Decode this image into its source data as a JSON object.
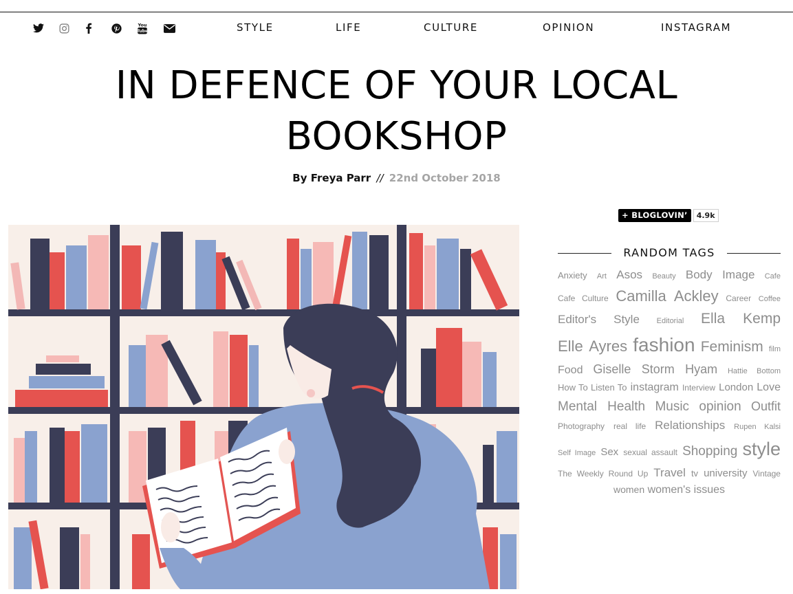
{
  "social": [
    {
      "name": "twitter-icon"
    },
    {
      "name": "instagram-icon"
    },
    {
      "name": "facebook-icon"
    },
    {
      "name": "pinterest-icon"
    },
    {
      "name": "youtube-icon",
      "text": "You Tube"
    },
    {
      "name": "email-icon"
    }
  ],
  "nav": [
    "STYLE",
    "LIFE",
    "CULTURE",
    "OPINION",
    "INSTAGRAM"
  ],
  "article": {
    "title": "IN DEFENCE OF YOUR LOCAL BOOKSHOP",
    "by": "By Freya Parr",
    "separator": "//",
    "date": "22nd October 2018"
  },
  "bloglovin": {
    "label": "BLOGLOVIN’",
    "count": "4.9k"
  },
  "tags": {
    "heading": "RANDOM TAGS",
    "items": [
      {
        "t": "Anxiety",
        "s": 13
      },
      {
        "t": "Art",
        "s": 11
      },
      {
        "t": "Asos",
        "s": 17
      },
      {
        "t": "Beauty",
        "s": 11
      },
      {
        "t": "Body Image",
        "s": 17
      },
      {
        "t": "Cafe",
        "s": 11
      },
      {
        "t": "Cafe Culture",
        "s": 12
      },
      {
        "t": "Camilla Ackley",
        "s": 22
      },
      {
        "t": "Career",
        "s": 12
      },
      {
        "t": "Coffee",
        "s": 11
      },
      {
        "t": "Editor's Style",
        "s": 17
      },
      {
        "t": "Editorial",
        "s": 11
      },
      {
        "t": "Ella Kemp",
        "s": 21
      },
      {
        "t": "Elle Ayres",
        "s": 22
      },
      {
        "t": "fashion",
        "s": 28
      },
      {
        "t": "Feminism",
        "s": 21
      },
      {
        "t": "film",
        "s": 11
      },
      {
        "t": "Food",
        "s": 16
      },
      {
        "t": "Giselle Storm Hyam",
        "s": 18
      },
      {
        "t": "Hattie Bottom",
        "s": 11
      },
      {
        "t": "How To Listen To",
        "s": 13
      },
      {
        "t": "instagram",
        "s": 16
      },
      {
        "t": "Interview",
        "s": 12
      },
      {
        "t": "London",
        "s": 15
      },
      {
        "t": "Love",
        "s": 16
      },
      {
        "t": "Mental Health",
        "s": 19
      },
      {
        "t": "Music",
        "s": 19
      },
      {
        "t": "opinion",
        "s": 19
      },
      {
        "t": "Outfit",
        "s": 18
      },
      {
        "t": "Photography",
        "s": 12
      },
      {
        "t": "real life",
        "s": 12
      },
      {
        "t": "Relationships",
        "s": 17
      },
      {
        "t": "Rupen Kalsi",
        "s": 11
      },
      {
        "t": "Self Image",
        "s": 11
      },
      {
        "t": "Sex",
        "s": 15
      },
      {
        "t": "sexual assault",
        "s": 12
      },
      {
        "t": "Shopping",
        "s": 19
      },
      {
        "t": "style",
        "s": 27
      },
      {
        "t": "The Weekly Round Up",
        "s": 12
      },
      {
        "t": "Travel",
        "s": 17
      },
      {
        "t": "tv",
        "s": 13
      },
      {
        "t": "university",
        "s": 15
      },
      {
        "t": "Vintage",
        "s": 12
      },
      {
        "t": "women",
        "s": 14
      },
      {
        "t": "women's issues",
        "s": 16
      }
    ]
  }
}
